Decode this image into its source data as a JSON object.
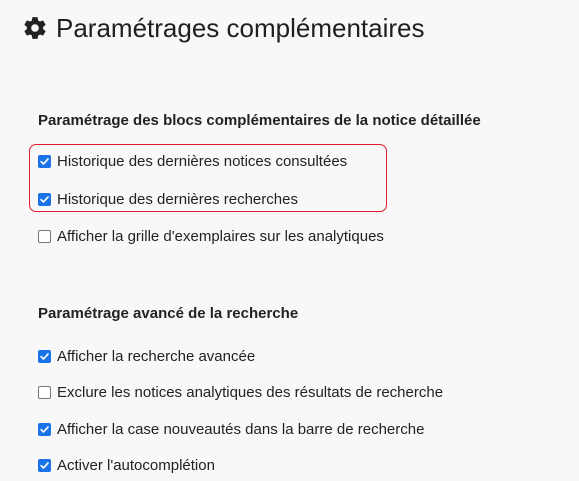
{
  "page": {
    "title": "Paramétrages complémentaires",
    "title_icon": "gear-icon"
  },
  "sections": [
    {
      "heading": "Paramétrage des blocs complémentaires de la notice détaillée",
      "options": [
        {
          "label": "Historique des dernières notices consultées",
          "checked": true
        },
        {
          "label": "Historique des dernières recherches",
          "checked": true
        },
        {
          "label": "Afficher la grille d'exemplaires sur les analytiques",
          "checked": false
        }
      ]
    },
    {
      "heading": "Paramétrage avancé de la recherche",
      "options": [
        {
          "label": "Afficher la recherche avancée",
          "checked": true
        },
        {
          "label": "Exclure les notices analytiques des résultats de recherche",
          "checked": false
        },
        {
          "label": "Afficher la case nouveautés dans la barre de recherche",
          "checked": true
        },
        {
          "label": "Activer l'autocomplétion",
          "checked": true
        }
      ]
    }
  ],
  "colors": {
    "checkbox_checked": "#1a73e8",
    "highlight_border": "#e21b2b",
    "background": "#f8f8f8"
  }
}
